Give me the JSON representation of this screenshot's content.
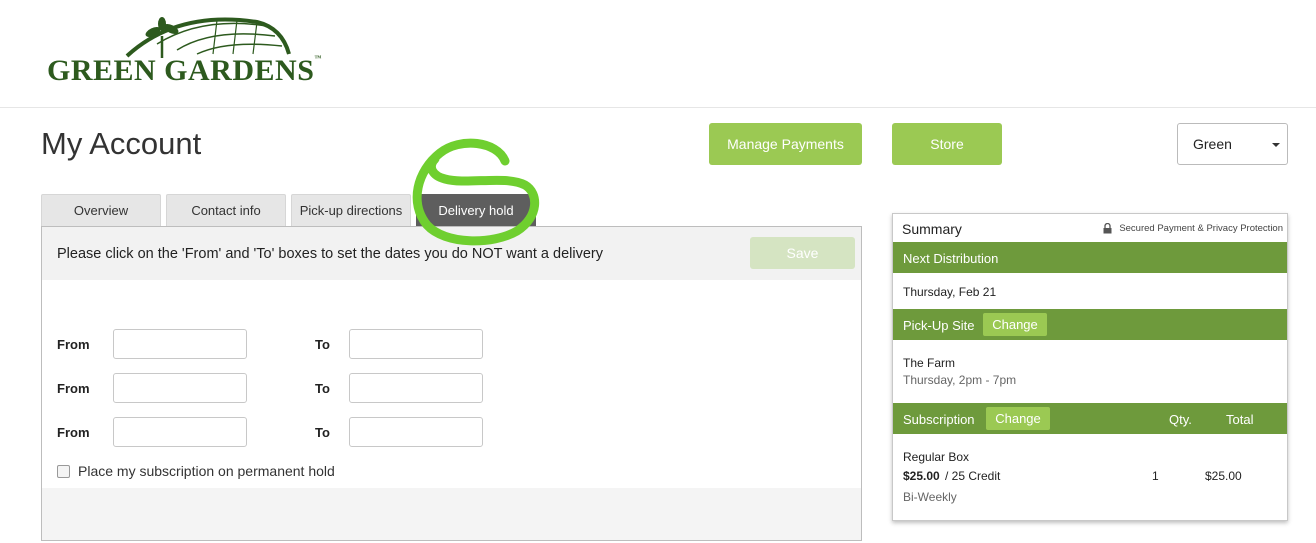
{
  "brand": {
    "logo_text": "GREEN GARDENS",
    "trademark": "™"
  },
  "page_title": "My Account",
  "header_buttons": {
    "manage_payments": "Manage Payments",
    "store": "Store"
  },
  "account_select": {
    "value": "Green"
  },
  "tabs": [
    {
      "label": "Overview",
      "active": false
    },
    {
      "label": "Contact info",
      "active": false
    },
    {
      "label": "Pick-up directions",
      "active": false
    },
    {
      "label": "Delivery hold",
      "active": true
    }
  ],
  "delivery_hold": {
    "instruction": "Please click on the 'From' and 'To' boxes to set the dates you do NOT want a delivery",
    "save_label": "Save",
    "rows": [
      {
        "from_label": "From",
        "to_label": "To",
        "from_value": "",
        "to_value": ""
      },
      {
        "from_label": "From",
        "to_label": "To",
        "from_value": "",
        "to_value": ""
      },
      {
        "from_label": "From",
        "to_label": "To",
        "from_value": "",
        "to_value": ""
      }
    ],
    "permanent_hold_label": "Place my subscription on permanent hold"
  },
  "summary": {
    "title": "Summary",
    "secure_text": "Secured Payment & Privacy Protection",
    "next_distribution_label": "Next Distribution",
    "next_distribution_date": "Thursday, Feb 21",
    "pickup_site_label": "Pick-Up Site",
    "change_label": "Change",
    "site_name": "The Farm",
    "site_hours": "Thursday, 2pm - 7pm",
    "subscription_label": "Subscription",
    "qty_label": "Qty.",
    "total_label": "Total",
    "item": {
      "name": "Regular Box",
      "price": "$25.00",
      "credit": "/ 25 Credit",
      "frequency": "Bi-Weekly",
      "qty": "1",
      "total": "$25.00"
    }
  },
  "colors": {
    "brand_green": "#2d5a1e",
    "accent": "#9bc953",
    "band": "#6e9a3c",
    "highlight_circle": "#6fcf2f"
  }
}
